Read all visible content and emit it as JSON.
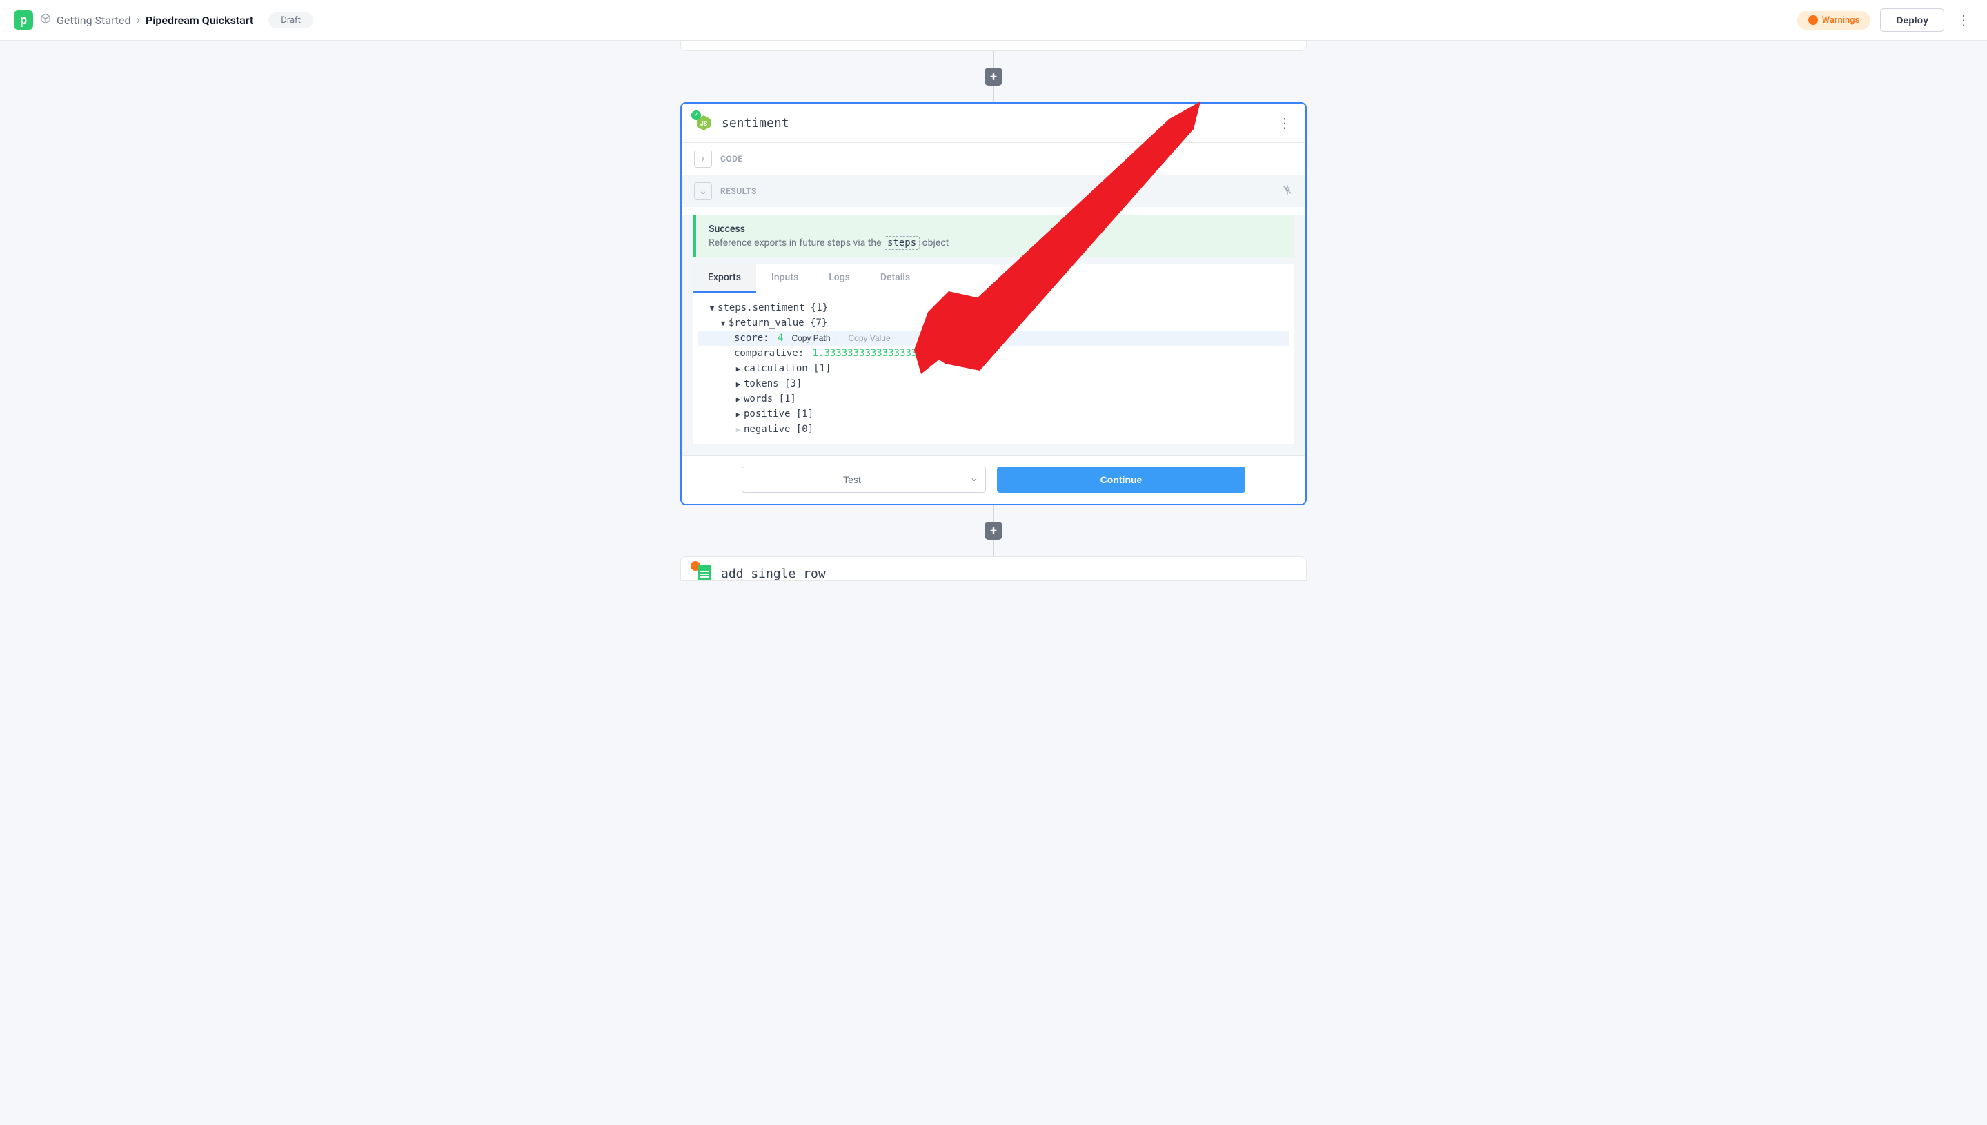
{
  "header": {
    "breadcrumb_parent": "Getting Started",
    "breadcrumb_current": "Pipedream Quickstart",
    "draft": "Draft",
    "warnings": "Warnings",
    "deploy": "Deploy"
  },
  "step": {
    "title": "sentiment",
    "code_label": "CODE",
    "results_label": "RESULTS",
    "success_title": "Success",
    "success_desc_pre": "Reference exports in future steps via the ",
    "success_desc_code": "steps",
    "success_desc_after": " object"
  },
  "tabs": {
    "exports": "Exports",
    "inputs": "Inputs",
    "logs": "Logs",
    "details": "Details"
  },
  "tree": {
    "root": "steps.sentiment {1}",
    "return": "$return_value {7}",
    "score_key": "score:",
    "score_val": "4",
    "copy_path": "Copy Path",
    "copy_value": "Copy Value",
    "comparative_key": "comparative:",
    "comparative_val": "1.3333333333333333",
    "calculation": "calculation [1]",
    "tokens": "tokens [3]",
    "words": "words [1]",
    "positive": "positive [1]",
    "negative": "negative [0]"
  },
  "actions": {
    "test": "Test",
    "continue": "Continue"
  },
  "next_step": {
    "title": "add_single_row"
  }
}
